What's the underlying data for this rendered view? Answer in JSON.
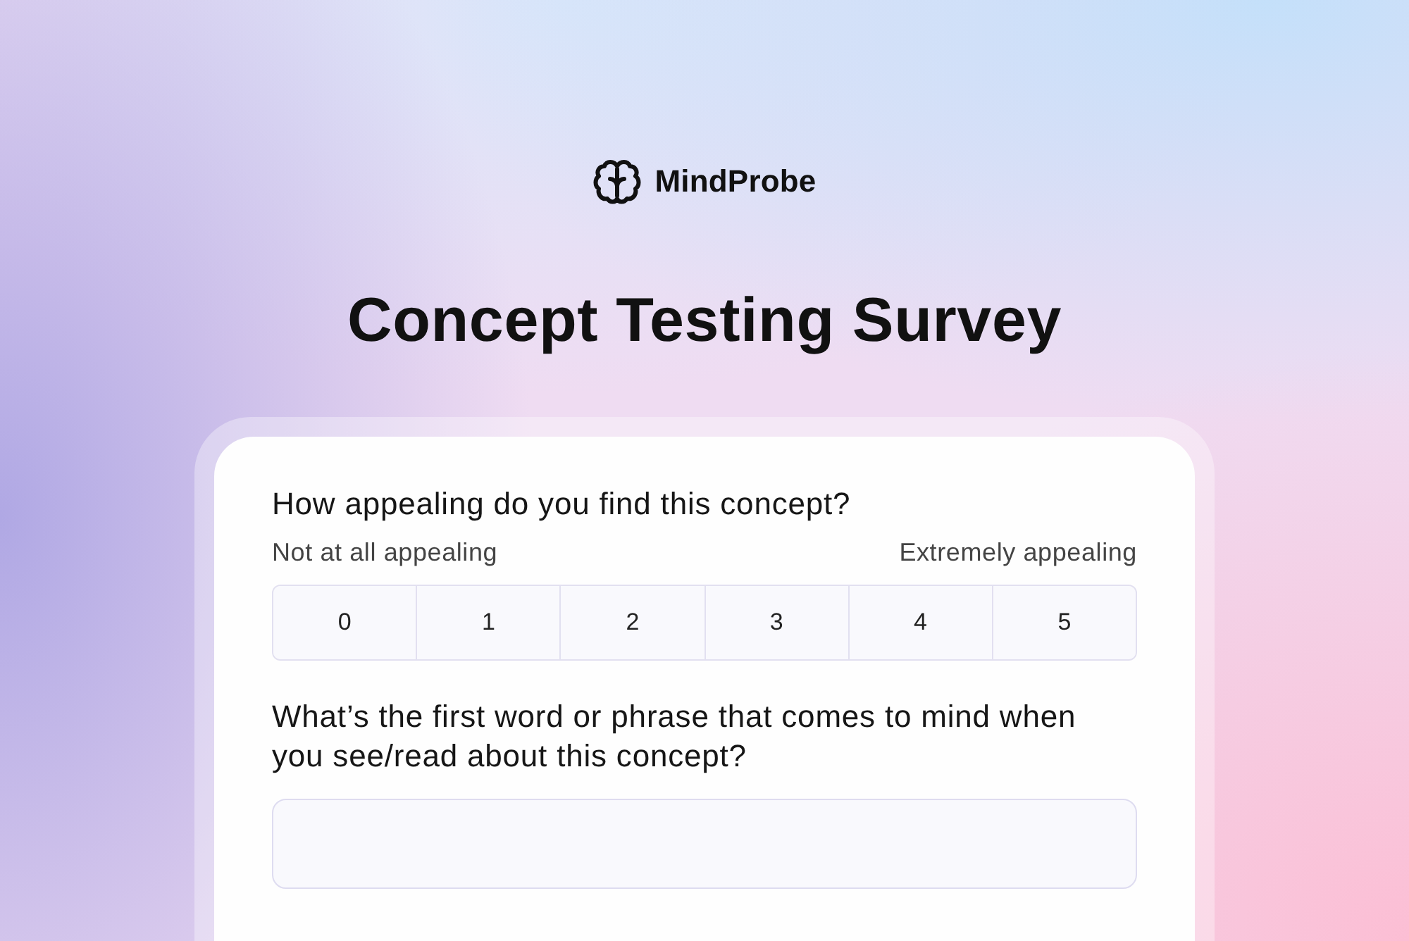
{
  "brand": {
    "name": "MindProbe"
  },
  "title": "Concept Testing Survey",
  "questions": [
    {
      "kind": "scale",
      "prompt": "How appealing do you find this concept?",
      "min_label": "Not at all appealing",
      "max_label": "Extremely appealing",
      "options": [
        {
          "label": "0",
          "selected": false
        },
        {
          "label": "1",
          "selected": false
        },
        {
          "label": "2",
          "selected": false
        },
        {
          "label": "3",
          "selected": false
        },
        {
          "label": "4",
          "selected": false
        },
        {
          "label": "5",
          "selected": false
        }
      ]
    },
    {
      "kind": "text",
      "prompt": "What’s the first word or phrase that comes to mind when you see/read about this concept?"
    }
  ]
}
